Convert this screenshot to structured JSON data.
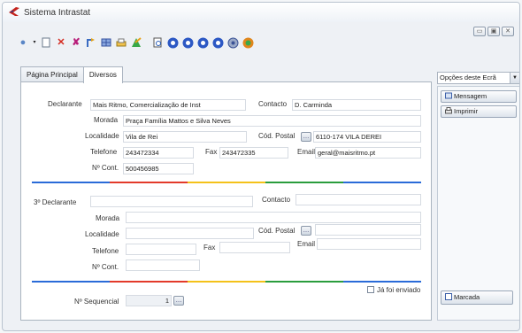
{
  "window": {
    "title": "Sistema Intrastat"
  },
  "toolbar": {
    "icons": [
      "new-icon",
      "dropdown-icon",
      "document-icon",
      "delete-icon",
      "cancel-icon",
      "export-icon",
      "grid-icon",
      "print-icon",
      "merge-icon",
      "preview-icon",
      "first-icon",
      "previous-icon",
      "next-icon",
      "last-icon",
      "refresh-icon",
      "exit-icon"
    ]
  },
  "tabs": [
    {
      "label": "Página Principal"
    },
    {
      "label": "Diversos"
    }
  ],
  "declarante": {
    "label": "Declarante",
    "value": "Mais Ritmo, Comercialização de Inst",
    "contacto_label": "Contacto",
    "contacto_value": "D. Carminda",
    "morada_label": "Morada",
    "morada_value": "Praça Família Mattos e Silva Neves",
    "localidade_label": "Localidade",
    "localidade_value": "Vila de Rei",
    "cod_postal_label": "Cód. Postal",
    "cod_postal_value": "6110-174 VILA DEREI",
    "telefone_label": "Telefone",
    "telefone_value": "243472334",
    "fax_label": "Fax",
    "fax_value": "243472335",
    "email_label": "Email",
    "email_value": "geral@maisritmo.pt",
    "ncont_label": "Nº Cont.",
    "ncont_value": "500456985"
  },
  "terceiro": {
    "label": "3º Declarante",
    "contacto_label": "Contacto",
    "morada_label": "Morada",
    "localidade_label": "Localidade",
    "cod_postal_label": "Cód. Postal",
    "telefone_label": "Telefone",
    "fax_label": "Fax",
    "email_label": "Email",
    "ncont_label": "Nº Cont."
  },
  "footer": {
    "sequencial_label": "Nº Sequencial",
    "sequencial_value": "1",
    "ja_enviado_label": "Já foi enviado"
  },
  "side": {
    "select_value": "Opções deste Ecrã",
    "buttons": [
      "Mensagem",
      "Imprimir"
    ],
    "bottom_button": "Marcada"
  }
}
